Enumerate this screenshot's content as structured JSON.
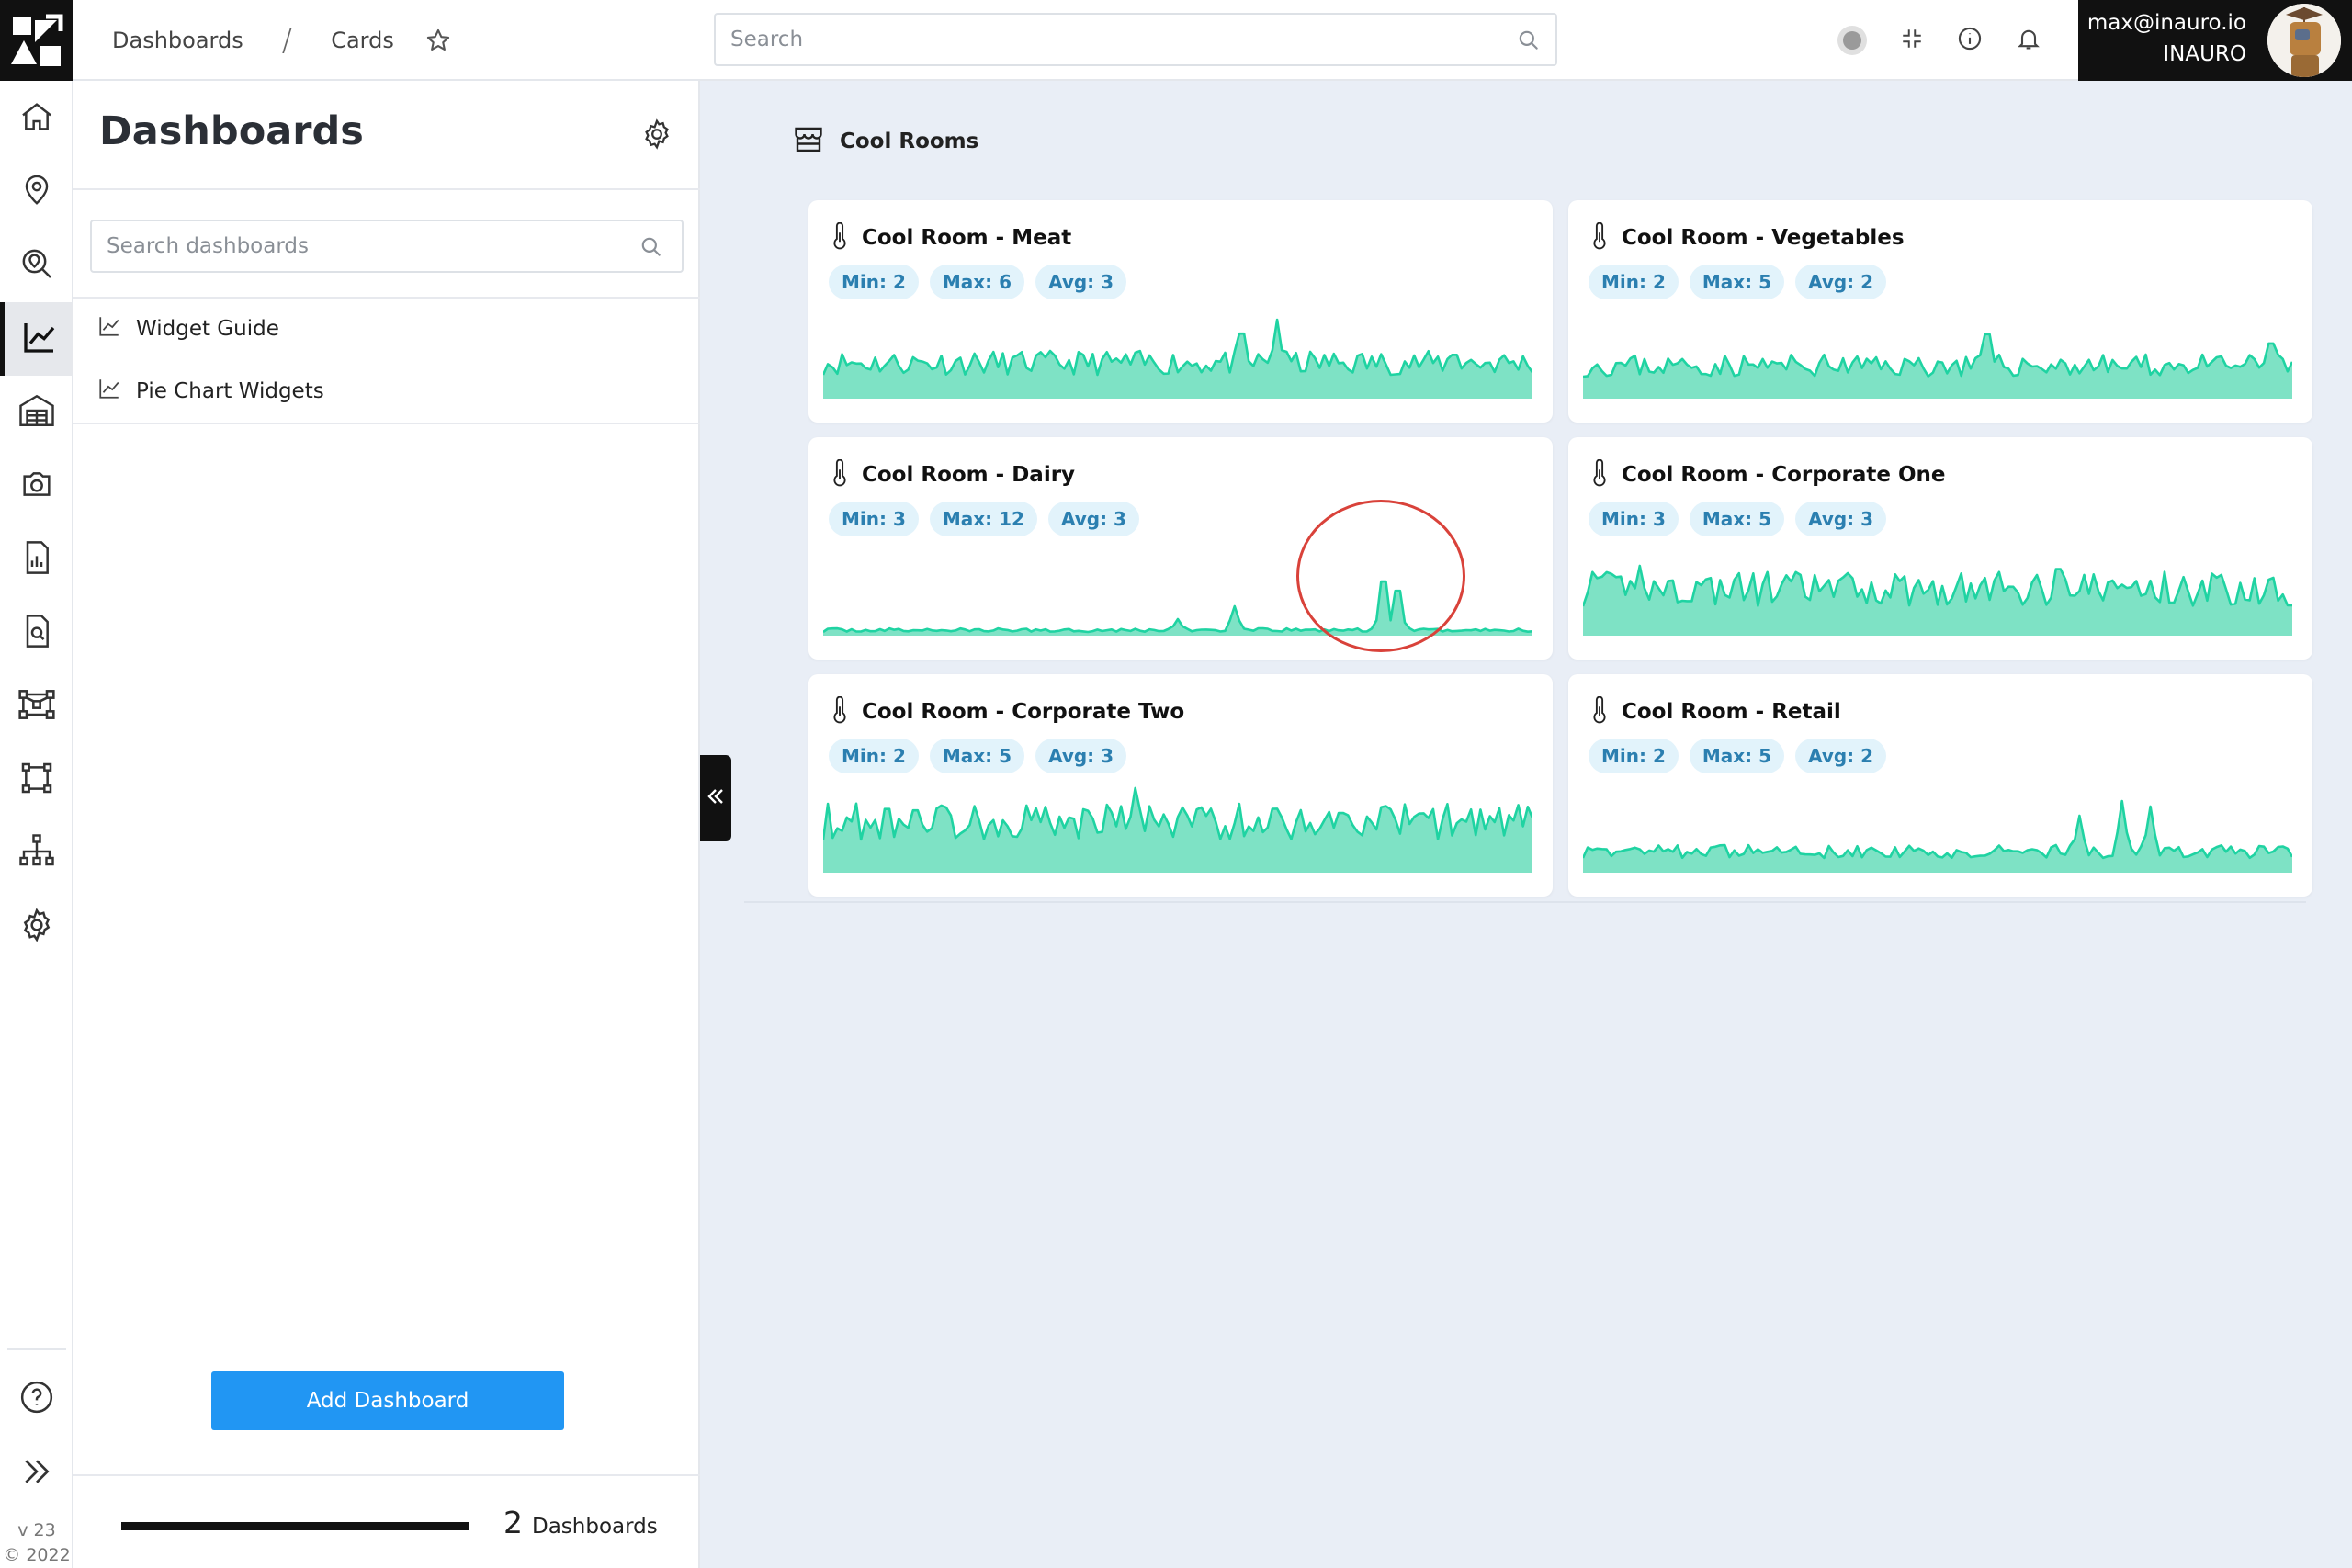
{
  "topbar": {
    "logo_icon": "inauro-logo",
    "breadcrumb": [
      "Dashboards",
      "Cards"
    ],
    "breadcrumb_separator": "/",
    "search_placeholder": "Search",
    "user_email": "max@inauro.io",
    "user_org": "INAURO"
  },
  "rail": {
    "items": [
      "home-icon",
      "location-pin-icon",
      "map-search-icon",
      "chart-line-icon",
      "warehouse-icon",
      "camera-icon",
      "report-icon",
      "document-search-icon",
      "network-icon",
      "polygon-icon",
      "hierarchy-icon",
      "gear-icon"
    ],
    "active_index": 3,
    "bottom_items": [
      "help-icon",
      "expand-icon"
    ],
    "version": "v 23",
    "copyright": "© 2022"
  },
  "panel": {
    "title": "Dashboards",
    "search_placeholder": "Search dashboards",
    "items": [
      {
        "label": "Widget Guide",
        "icon": "chart-line-icon"
      },
      {
        "label": "Pie Chart Widgets",
        "icon": "chart-line-icon"
      }
    ],
    "add_button": "Add Dashboard",
    "count": "2",
    "count_label": "Dashboards"
  },
  "main": {
    "group_title": "Cool Rooms",
    "group_icon": "store-icon",
    "accent_color": "#1fd3a2",
    "cards": [
      {
        "title": "Cool Room - Meat",
        "min": "Min: 2",
        "max": "Max: 6",
        "avg": "Avg: 3"
      },
      {
        "title": "Cool Room - Vegetables",
        "min": "Min: 2",
        "max": "Max: 5",
        "avg": "Avg: 2"
      },
      {
        "title": "Cool Room - Dairy",
        "min": "Min: 3",
        "max": "Max: 12",
        "avg": "Avg: 3"
      },
      {
        "title": "Cool Room - Corporate One",
        "min": "Min: 3",
        "max": "Max: 5",
        "avg": "Avg: 3"
      },
      {
        "title": "Cool Room - Corporate Two",
        "min": "Min: 2",
        "max": "Max: 5",
        "avg": "Avg: 3"
      },
      {
        "title": "Cool Room - Retail",
        "min": "Min: 2",
        "max": "Max: 5",
        "avg": "Avg: 2"
      }
    ]
  }
}
